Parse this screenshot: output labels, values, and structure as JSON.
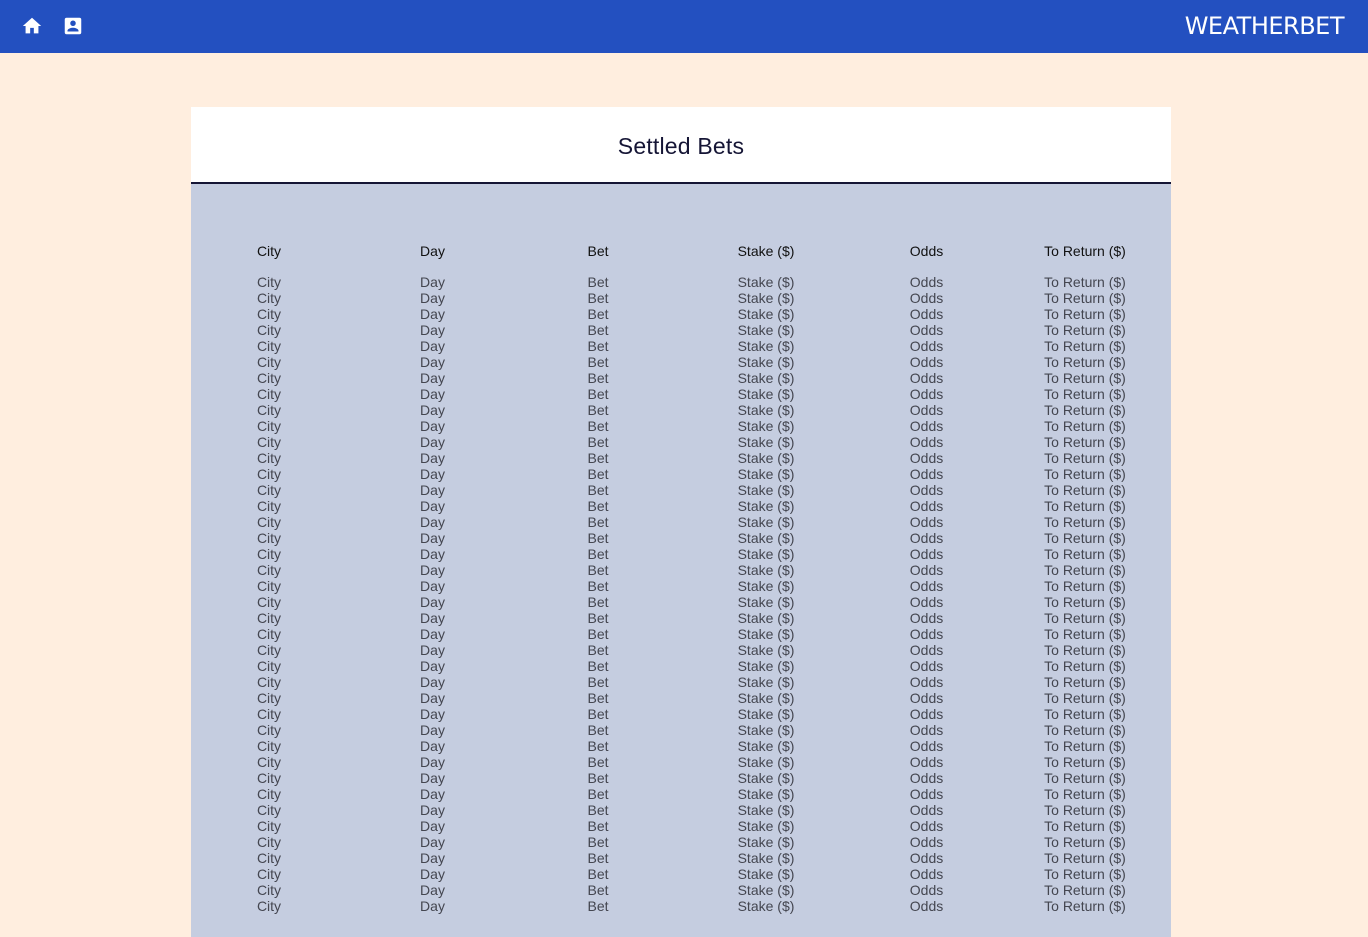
{
  "header": {
    "brand": "WEATHERBET",
    "icons": [
      "home-icon",
      "contact-card-icon"
    ],
    "background_color": "#2350C0"
  },
  "page": {
    "background_color": "#FFEEDF"
  },
  "panel": {
    "title": "Settled Bets",
    "background_color": "#C5CDE0"
  },
  "table": {
    "columns": [
      "City",
      "Day",
      "Bet",
      "Stake ($)",
      "Odds",
      "To Return ($)"
    ],
    "rows": [
      [
        "City",
        "Day",
        "Bet",
        "Stake ($)",
        "Odds",
        "To Return ($)"
      ],
      [
        "City",
        "Day",
        "Bet",
        "Stake ($)",
        "Odds",
        "To Return ($)"
      ],
      [
        "City",
        "Day",
        "Bet",
        "Stake ($)",
        "Odds",
        "To Return ($)"
      ],
      [
        "City",
        "Day",
        "Bet",
        "Stake ($)",
        "Odds",
        "To Return ($)"
      ],
      [
        "City",
        "Day",
        "Bet",
        "Stake ($)",
        "Odds",
        "To Return ($)"
      ],
      [
        "City",
        "Day",
        "Bet",
        "Stake ($)",
        "Odds",
        "To Return ($)"
      ],
      [
        "City",
        "Day",
        "Bet",
        "Stake ($)",
        "Odds",
        "To Return ($)"
      ],
      [
        "City",
        "Day",
        "Bet",
        "Stake ($)",
        "Odds",
        "To Return ($)"
      ],
      [
        "City",
        "Day",
        "Bet",
        "Stake ($)",
        "Odds",
        "To Return ($)"
      ],
      [
        "City",
        "Day",
        "Bet",
        "Stake ($)",
        "Odds",
        "To Return ($)"
      ],
      [
        "City",
        "Day",
        "Bet",
        "Stake ($)",
        "Odds",
        "To Return ($)"
      ],
      [
        "City",
        "Day",
        "Bet",
        "Stake ($)",
        "Odds",
        "To Return ($)"
      ],
      [
        "City",
        "Day",
        "Bet",
        "Stake ($)",
        "Odds",
        "To Return ($)"
      ],
      [
        "City",
        "Day",
        "Bet",
        "Stake ($)",
        "Odds",
        "To Return ($)"
      ],
      [
        "City",
        "Day",
        "Bet",
        "Stake ($)",
        "Odds",
        "To Return ($)"
      ],
      [
        "City",
        "Day",
        "Bet",
        "Stake ($)",
        "Odds",
        "To Return ($)"
      ],
      [
        "City",
        "Day",
        "Bet",
        "Stake ($)",
        "Odds",
        "To Return ($)"
      ],
      [
        "City",
        "Day",
        "Bet",
        "Stake ($)",
        "Odds",
        "To Return ($)"
      ],
      [
        "City",
        "Day",
        "Bet",
        "Stake ($)",
        "Odds",
        "To Return ($)"
      ],
      [
        "City",
        "Day",
        "Bet",
        "Stake ($)",
        "Odds",
        "To Return ($)"
      ],
      [
        "City",
        "Day",
        "Bet",
        "Stake ($)",
        "Odds",
        "To Return ($)"
      ],
      [
        "City",
        "Day",
        "Bet",
        "Stake ($)",
        "Odds",
        "To Return ($)"
      ],
      [
        "City",
        "Day",
        "Bet",
        "Stake ($)",
        "Odds",
        "To Return ($)"
      ],
      [
        "City",
        "Day",
        "Bet",
        "Stake ($)",
        "Odds",
        "To Return ($)"
      ],
      [
        "City",
        "Day",
        "Bet",
        "Stake ($)",
        "Odds",
        "To Return ($)"
      ],
      [
        "City",
        "Day",
        "Bet",
        "Stake ($)",
        "Odds",
        "To Return ($)"
      ],
      [
        "City",
        "Day",
        "Bet",
        "Stake ($)",
        "Odds",
        "To Return ($)"
      ],
      [
        "City",
        "Day",
        "Bet",
        "Stake ($)",
        "Odds",
        "To Return ($)"
      ],
      [
        "City",
        "Day",
        "Bet",
        "Stake ($)",
        "Odds",
        "To Return ($)"
      ],
      [
        "City",
        "Day",
        "Bet",
        "Stake ($)",
        "Odds",
        "To Return ($)"
      ],
      [
        "City",
        "Day",
        "Bet",
        "Stake ($)",
        "Odds",
        "To Return ($)"
      ],
      [
        "City",
        "Day",
        "Bet",
        "Stake ($)",
        "Odds",
        "To Return ($)"
      ],
      [
        "City",
        "Day",
        "Bet",
        "Stake ($)",
        "Odds",
        "To Return ($)"
      ],
      [
        "City",
        "Day",
        "Bet",
        "Stake ($)",
        "Odds",
        "To Return ($)"
      ],
      [
        "City",
        "Day",
        "Bet",
        "Stake ($)",
        "Odds",
        "To Return ($)"
      ],
      [
        "City",
        "Day",
        "Bet",
        "Stake ($)",
        "Odds",
        "To Return ($)"
      ],
      [
        "City",
        "Day",
        "Bet",
        "Stake ($)",
        "Odds",
        "To Return ($)"
      ],
      [
        "City",
        "Day",
        "Bet",
        "Stake ($)",
        "Odds",
        "To Return ($)"
      ],
      [
        "City",
        "Day",
        "Bet",
        "Stake ($)",
        "Odds",
        "To Return ($)"
      ],
      [
        "City",
        "Day",
        "Bet",
        "Stake ($)",
        "Odds",
        "To Return ($)"
      ]
    ]
  }
}
